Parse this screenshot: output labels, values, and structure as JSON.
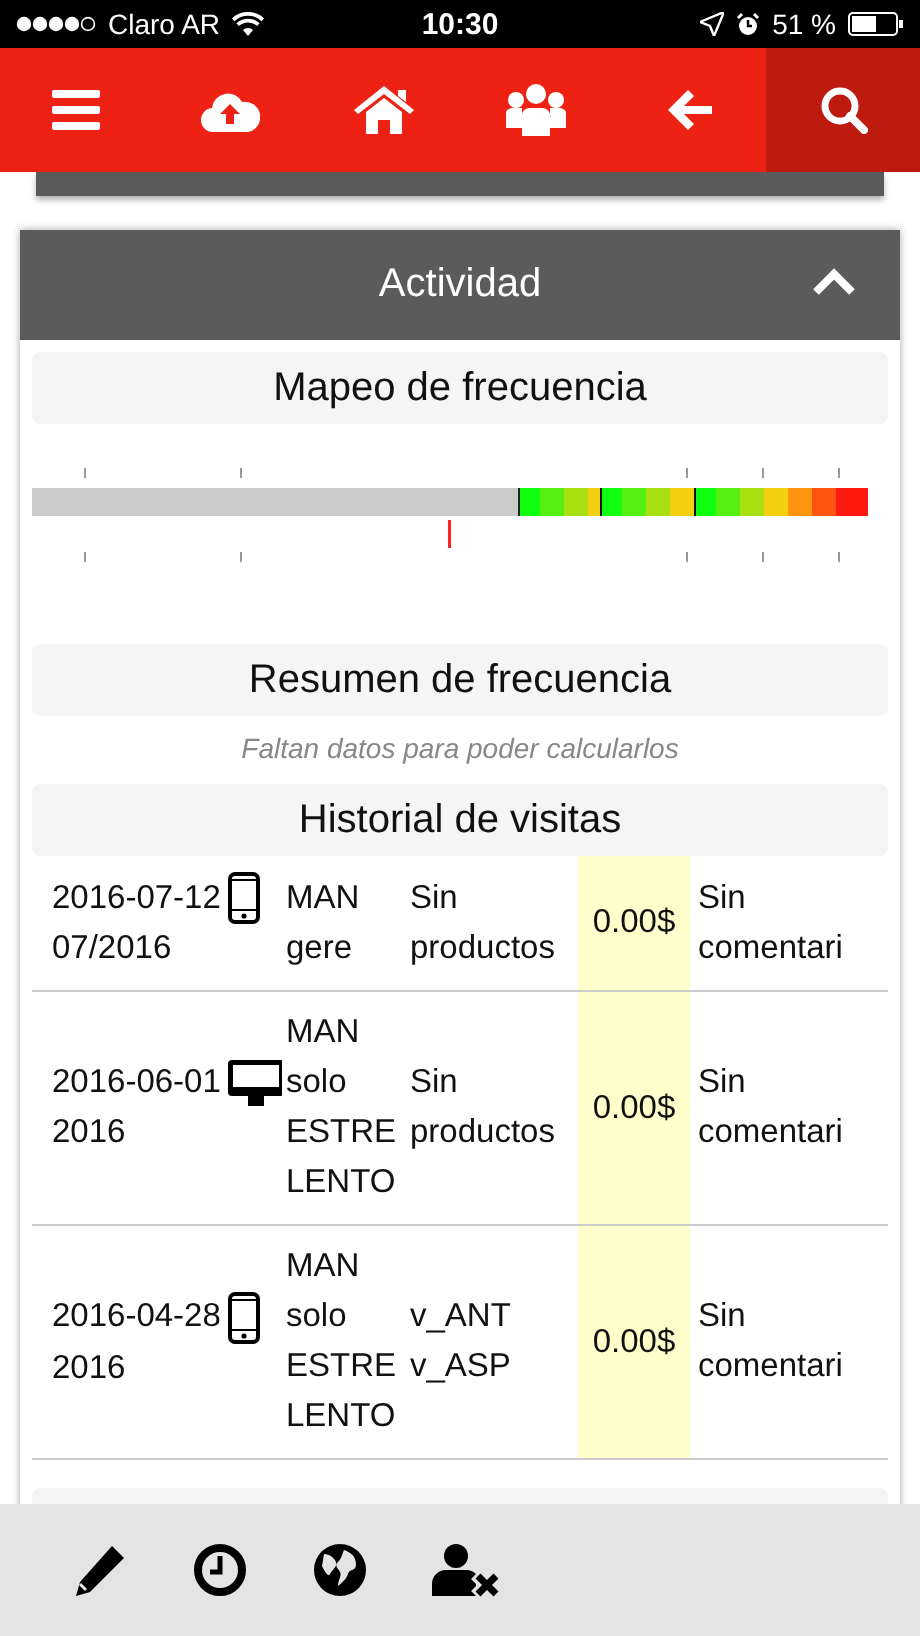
{
  "status_bar": {
    "carrier": "Claro AR",
    "time": "10:30",
    "battery": "51 %"
  },
  "nav": [
    {
      "selected": false
    },
    {
      "selected": false
    },
    {
      "selected": false
    },
    {
      "selected": false
    },
    {
      "selected": false
    },
    {
      "selected": true
    }
  ],
  "activity": {
    "title": "Actividad",
    "expanded": true,
    "frequency_map": {
      "title": "Mapeo de frecuencia"
    },
    "frequency_summary": {
      "title": "Resumen de frecuencia",
      "note": "Faltan datos para poder calcularlos"
    },
    "visit_history": {
      "title": "Historial de visitas",
      "rows": [
        {
          "date": "2016-07-12",
          "kind": "phone",
          "period": "07/2016",
          "user": "MAN gere",
          "products": "Sin productos",
          "amount": "0.00$",
          "comment": "Sin comentari"
        },
        {
          "date": "2016-06-01",
          "kind": "desktop",
          "period": "2016",
          "user": "MAN solo ESTRE LENTO",
          "products": "Sin productos",
          "amount": "0.00$",
          "comment": "Sin comentari"
        },
        {
          "date": "2016-04-28",
          "kind": "phone",
          "period": "2016",
          "user": "MAN solo ESTRE LENTO",
          "products": "v_ANT v_ASP",
          "amount": "0.00$",
          "comment": "Sin comentari"
        }
      ]
    }
  }
}
